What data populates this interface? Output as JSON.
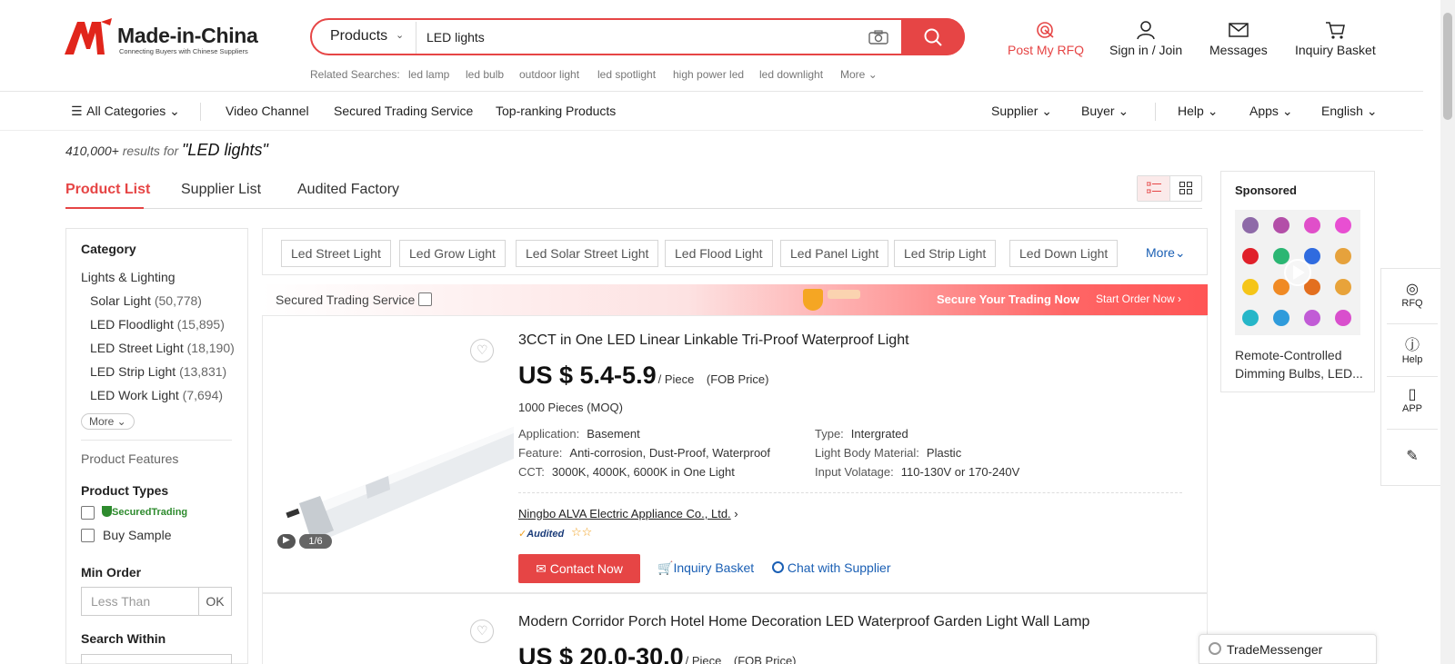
{
  "brand": {
    "name": "Made-in-China",
    "tagline": "Connecting Buyers with Chinese Suppliers"
  },
  "search": {
    "category": "Products",
    "query": "LED lights"
  },
  "related": {
    "label": "Related Searches:",
    "items": [
      "led lamp",
      "led bulb",
      "outdoor light",
      "led spotlight",
      "high power led",
      "led downlight",
      "More"
    ]
  },
  "top_actions": {
    "rfq": "Post My RFQ",
    "sign_in": "Sign in / Join",
    "messages": "Messages",
    "basket": "Inquiry Basket"
  },
  "nav": {
    "all_categories": "All Categories",
    "items": [
      "Video Channel",
      "Secured Trading Service",
      "Top-ranking Products"
    ],
    "right": [
      "Supplier",
      "Buyer",
      "Help",
      "Apps",
      "English"
    ]
  },
  "results": {
    "count": "410,000+",
    "label": "results for",
    "query": "\"LED lights\""
  },
  "tabs": [
    "Product List",
    "Supplier List",
    "Audited Factory"
  ],
  "sidebar": {
    "category_title": "Category",
    "parent": "Lights & Lighting",
    "subs": [
      {
        "name": "Solar Light",
        "count": "(50,778)"
      },
      {
        "name": "LED Floodlight",
        "count": "(15,895)"
      },
      {
        "name": "LED Street Light",
        "count": "(18,190)"
      },
      {
        "name": "LED Strip Light",
        "count": "(13,831)"
      },
      {
        "name": "LED Work Light",
        "count": "(7,694)"
      }
    ],
    "more": "More",
    "features_title": "Product Features",
    "types_title": "Product Types",
    "secured_trading": "SecuredTrading",
    "buy_sample": "Buy Sample",
    "min_order_title": "Min Order",
    "min_order_placeholder": "Less Than",
    "ok": "OK",
    "search_within": "Search Within"
  },
  "chips": [
    "Led Street Light",
    "Led Grow Light",
    "Led Solar Street Light",
    "Led Flood Light",
    "Led Panel Light",
    "Led Strip Light",
    "Led Down Light"
  ],
  "chips_more": "More",
  "banner": {
    "left": "Secured Trading Service",
    "center": "Secure Your Trading Now",
    "right": "Start Order Now"
  },
  "products": [
    {
      "title": "3CCT in One LED Linear Linkable Tri-Proof Waterproof Light",
      "price": "US $ 5.4-5.9",
      "unit": "/ Piece",
      "fob": "(FOB Price)",
      "moq": "1000 Pieces",
      "moq_label": "(MOQ)",
      "attrs_left": [
        {
          "k": "Application:",
          "v": "Basement"
        },
        {
          "k": "Feature:",
          "v": "Anti-corrosion, Dust-Proof, Waterproof"
        },
        {
          "k": "CCT:",
          "v": "3000K, 4000K, 6000K in One Light"
        }
      ],
      "attrs_right": [
        {
          "k": "Type:",
          "v": "Intergrated"
        },
        {
          "k": "Light Body Material:",
          "v": "Plastic"
        },
        {
          "k": "Input Volatage:",
          "v": "110-130V or 170-240V"
        }
      ],
      "supplier": "Ningbo ALVA Electric Appliance Co., Ltd.",
      "audited": "Audited",
      "image_counter": "1/6",
      "contact": "Contact Now",
      "basket": "Inquiry Basket",
      "chat": "Chat with Supplier"
    },
    {
      "title": "Modern Corridor Porch Hotel Home Decoration LED Waterproof Garden Light Wall Lamp",
      "price": "US $ 20.0-30.0",
      "unit": "/ Piece",
      "fob": "(FOB Price)"
    }
  ],
  "sponsored": {
    "title": "Sponsored",
    "caption": "Remote-Controlled Dimming Bulbs, LED..."
  },
  "right_float": [
    "RFQ",
    "Help",
    "APP"
  ],
  "trade_messenger": "TradeMessenger",
  "colors": {
    "accent": "#e64545",
    "link": "#1a5fb4"
  }
}
